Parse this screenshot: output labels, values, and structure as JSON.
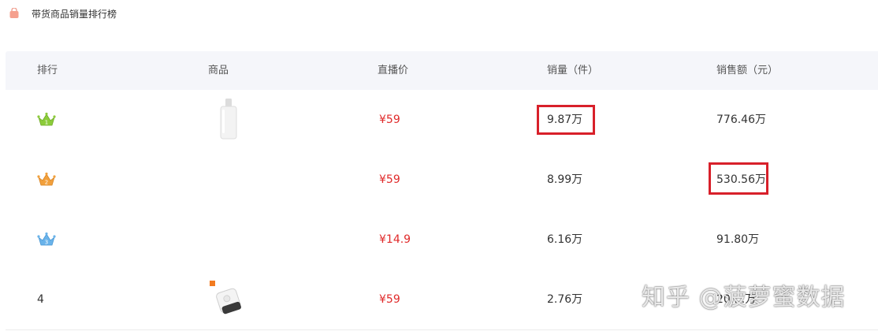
{
  "section": {
    "title": "带货商品销量排行榜",
    "icon": "shopping-bag-icon"
  },
  "table": {
    "headers": [
      "排行",
      "商品",
      "直播价",
      "销量（件）",
      "销售额（元）"
    ],
    "rows": [
      {
        "rank": "1",
        "rank_icon": "crown-green-icon",
        "rank_color": "#8ccc3a",
        "product_icon": "soap-dispenser-image",
        "price": "¥59",
        "sales": "9.87万",
        "revenue": "776.46万",
        "sales_highlighted": true,
        "revenue_highlighted": false
      },
      {
        "rank": "2",
        "rank_icon": "crown-orange-icon",
        "rank_color": "#f2a03c",
        "product_icon": "",
        "price": "¥59",
        "sales": "8.99万",
        "revenue": "530.56万",
        "sales_highlighted": false,
        "revenue_highlighted": true
      },
      {
        "rank": "3",
        "rank_icon": "crown-blue-icon",
        "rank_color": "#6ab3ea",
        "product_icon": "",
        "price": "¥14.9",
        "sales": "6.16万",
        "revenue": "91.80万",
        "sales_highlighted": false,
        "revenue_highlighted": false
      },
      {
        "rank": "4",
        "rank_icon": "",
        "product_icon": "smart-plug-image",
        "price": "¥59",
        "sales": "2.76万",
        "revenue": "20.…万",
        "sales_highlighted": false,
        "revenue_highlighted": false
      }
    ]
  },
  "watermark": {
    "text": "知乎 @菠萝蜜数据"
  },
  "colors": {
    "price": "#e02a2a",
    "highlight_box": "#d8202a",
    "header_bg": "#f5f6fa"
  }
}
